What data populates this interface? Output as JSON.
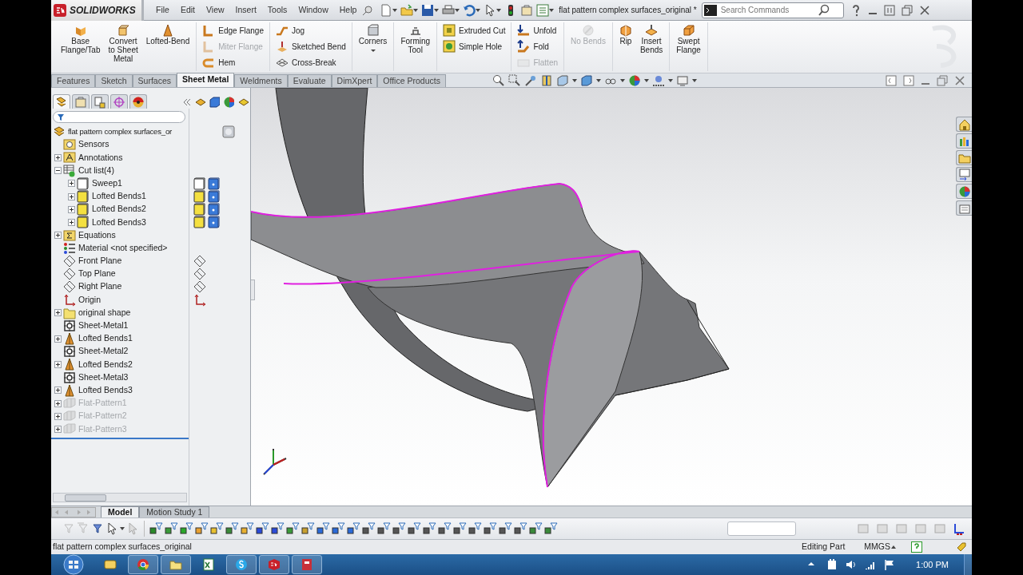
{
  "app_bar": {
    "logo": "SOLIDWORKS",
    "menu": [
      "File",
      "Edit",
      "View",
      "Insert",
      "Tools",
      "Window",
      "Help"
    ],
    "document_title": "flat pattern complex surfaces_original *",
    "search": {
      "placeholder": "Search Commands"
    }
  },
  "ribbon": {
    "groups": [
      {
        "kind": "large",
        "items": [
          {
            "label": "Base\nFlange/Tab",
            "disabled": false
          },
          {
            "label": "Convert\nto Sheet\nMetal",
            "disabled": false
          },
          {
            "label": "Lofted-Bend",
            "disabled": false
          }
        ]
      },
      {
        "kind": "stack",
        "items": [
          {
            "label": "Edge Flange",
            "disabled": false
          },
          {
            "label": "Miter Flange",
            "disabled": true
          },
          {
            "label": "Hem",
            "disabled": false
          }
        ]
      },
      {
        "kind": "stack",
        "items": [
          {
            "label": "Jog",
            "disabled": false
          },
          {
            "label": "Sketched Bend",
            "disabled": false
          },
          {
            "label": "Cross-Break",
            "disabled": false
          }
        ]
      },
      {
        "kind": "large",
        "items": [
          {
            "label": "Corners",
            "disabled": false,
            "dropdown": true
          }
        ]
      },
      {
        "kind": "large",
        "items": [
          {
            "label": "Forming\nTool",
            "disabled": false
          }
        ]
      },
      {
        "kind": "stack",
        "items": [
          {
            "label": "Extruded Cut",
            "disabled": false
          },
          {
            "label": "Simple Hole",
            "disabled": false
          }
        ]
      },
      {
        "kind": "stack",
        "items": [
          {
            "label": "Unfold",
            "disabled": false
          },
          {
            "label": "Fold",
            "disabled": false
          },
          {
            "label": "Flatten",
            "disabled": true
          }
        ]
      },
      {
        "kind": "large",
        "items": [
          {
            "label": "No Bends",
            "disabled": true
          }
        ]
      },
      {
        "kind": "large",
        "items": [
          {
            "label": "Rip",
            "disabled": false
          },
          {
            "label": "Insert\nBends",
            "disabled": false
          }
        ]
      },
      {
        "kind": "large",
        "items": [
          {
            "label": "Swept\nFlange",
            "disabled": false
          }
        ]
      }
    ]
  },
  "command_tabs": [
    {
      "label": "Features",
      "selected": false
    },
    {
      "label": "Sketch",
      "selected": false
    },
    {
      "label": "Surfaces",
      "selected": false
    },
    {
      "label": "Sheet Metal",
      "selected": true
    },
    {
      "label": "Weldments",
      "selected": false
    },
    {
      "label": "Evaluate",
      "selected": false
    },
    {
      "label": "DimXpert",
      "selected": false
    },
    {
      "label": "Office Products",
      "selected": false
    }
  ],
  "feature_tree": {
    "panel_tabs": [
      {
        "kind": "tree",
        "selected": true
      },
      {
        "kind": "property",
        "selected": false
      },
      {
        "kind": "config",
        "selected": false
      },
      {
        "kind": "dimxpert",
        "selected": false
      },
      {
        "kind": "display",
        "selected": false
      }
    ],
    "items": [
      {
        "label": "flat pattern complex surfaces_or",
        "kind": "part",
        "suppressed": false,
        "children": [
          {
            "label": "Sensors",
            "kind": "sensor",
            "suppressed": false
          },
          {
            "label": "Annotations",
            "kind": "annotation",
            "suppressed": false,
            "expanded": false
          },
          {
            "label": "Cut list(4)",
            "kind": "cutlist",
            "suppressed": false,
            "expanded": true,
            "children": [
              {
                "label": "Sweep1",
                "kind": "body-empty",
                "suppressed": false,
                "expanded": false
              },
              {
                "label": "Lofted Bends1",
                "kind": "body",
                "suppressed": false,
                "expanded": false
              },
              {
                "label": "Lofted Bends2",
                "kind": "body",
                "suppressed": false,
                "expanded": false
              },
              {
                "label": "Lofted Bends3",
                "kind": "body",
                "suppressed": false,
                "expanded": false
              }
            ]
          },
          {
            "label": "Equations",
            "kind": "equation",
            "suppressed": false,
            "expanded": false
          },
          {
            "label": "Material <not specified>",
            "kind": "material",
            "suppressed": false
          },
          {
            "label": "Front Plane",
            "kind": "plane",
            "suppressed": false
          },
          {
            "label": "Top Plane",
            "kind": "plane",
            "suppressed": false
          },
          {
            "label": "Right Plane",
            "kind": "plane",
            "suppressed": false
          },
          {
            "label": "Origin",
            "kind": "origin",
            "suppressed": false
          },
          {
            "label": "original shape",
            "kind": "folder",
            "suppressed": false,
            "expanded": false
          },
          {
            "label": "Sheet-Metal1",
            "kind": "sheetmetal",
            "suppressed": false
          },
          {
            "label": "Lofted Bends1",
            "kind": "lofted",
            "suppressed": false,
            "expanded": false
          },
          {
            "label": "Sheet-Metal2",
            "kind": "sheetmetal",
            "suppressed": false
          },
          {
            "label": "Lofted Bends2",
            "kind": "lofted",
            "suppressed": false,
            "expanded": false
          },
          {
            "label": "Sheet-Metal3",
            "kind": "sheetmetal",
            "suppressed": false
          },
          {
            "label": "Lofted Bends3",
            "kind": "lofted",
            "suppressed": false,
            "expanded": false
          },
          {
            "label": "Flat-Pattern1",
            "kind": "flatpattern",
            "suppressed": true,
            "expanded": false
          },
          {
            "label": "Flat-Pattern2",
            "kind": "flatpattern",
            "suppressed": true,
            "expanded": false
          },
          {
            "label": "Flat-Pattern3",
            "kind": "flatpattern",
            "suppressed": true,
            "expanded": false
          }
        ]
      }
    ]
  },
  "bottom_tabs": [
    {
      "label": "Model",
      "selected": true
    },
    {
      "label": "Motion Study 1",
      "selected": false
    }
  ],
  "status_bar": {
    "document": "flat pattern complex surfaces_original",
    "mode": "Editing Part",
    "units": "MMGS"
  },
  "taskbar": {
    "apps": [
      {
        "kind": "mail",
        "running": false
      },
      {
        "kind": "browser",
        "running": true
      },
      {
        "kind": "files",
        "running": true
      },
      {
        "kind": "sheet",
        "running": false
      },
      {
        "kind": "chat",
        "running": true
      },
      {
        "kind": "cad",
        "running": true
      },
      {
        "kind": "pdf",
        "running": true
      }
    ],
    "clock": "1:00 PM"
  }
}
